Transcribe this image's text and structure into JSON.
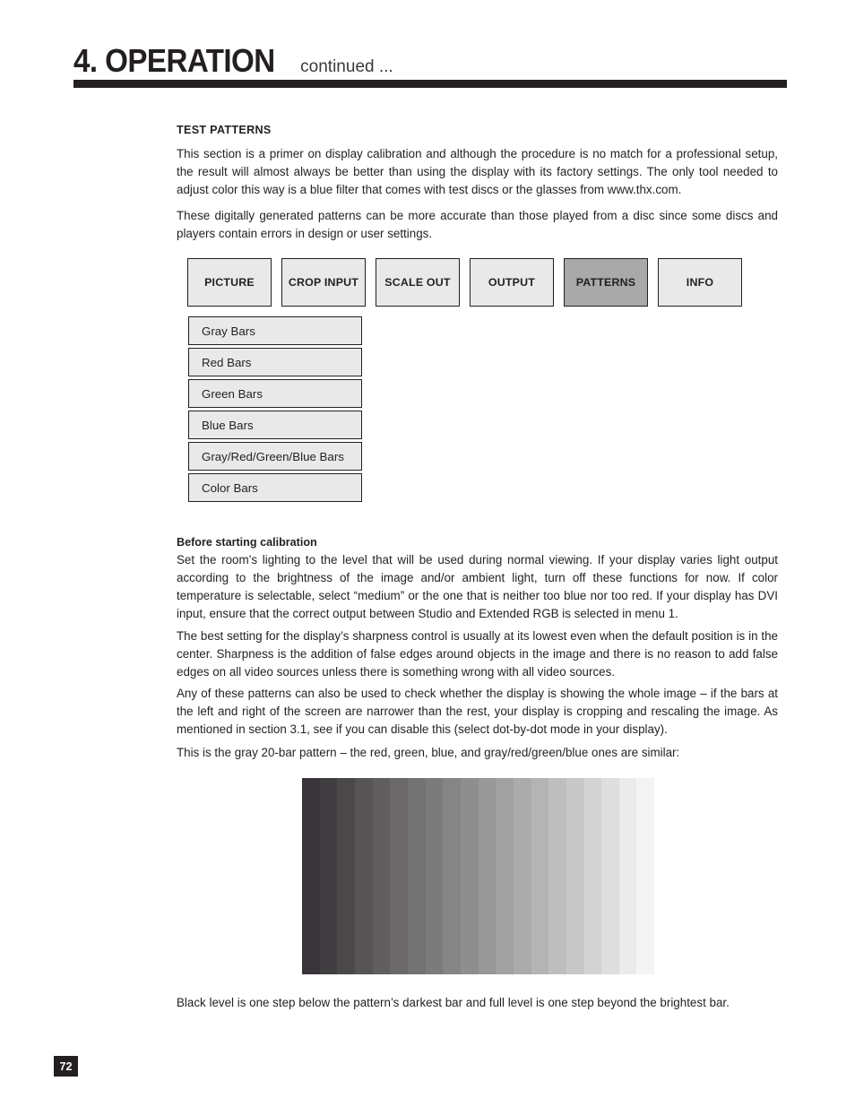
{
  "header": {
    "chapter": "4. OPERATION",
    "continued": "continued ..."
  },
  "section": {
    "title": "TEST PATTERNS",
    "intro_paragraph_1": "This section is a primer on display calibration and although the procedure is no match for a professional setup, the result will almost always be better than using the display with its factory settings. The only tool needed to adjust color this way is a blue filter that comes with test discs or the glasses from www.thx.com.",
    "intro_paragraph_2": "These digitally generated patterns can be more accurate than those played from a disc since some discs and players contain errors in design or user settings."
  },
  "tabs": [
    {
      "label": "PICTURE",
      "active": false
    },
    {
      "label": "CROP INPUT",
      "active": false
    },
    {
      "label": "SCALE OUT",
      "active": false
    },
    {
      "label": "OUTPUT",
      "active": false
    },
    {
      "label": "PATTERNS",
      "active": true
    },
    {
      "label": "INFO",
      "active": false
    }
  ],
  "menu_items": [
    {
      "label": "Gray Bars"
    },
    {
      "label": "Red Bars"
    },
    {
      "label": "Green Bars"
    },
    {
      "label": "Blue Bars"
    },
    {
      "label": "Gray/Red/Green/Blue Bars"
    },
    {
      "label": "Color Bars"
    }
  ],
  "calibration": {
    "heading": "Before starting calibration",
    "paragraph_1": "Set the room’s lighting to the level that will be used during normal viewing. If your display varies light output according to the brightness of the image and/or ambient light, turn off these functions for now. If color temperature is selectable, select “medium” or the one that is neither too blue nor too red. If your display has DVI input, ensure that the correct output between Studio and Extended RGB is selected in menu 1.",
    "paragraph_2": "The best setting for the display’s sharpness control is usually at its lowest even when the default position is in the center. Sharpness is the addition of false edges around objects in the image and there is no reason to add false edges on all video sources unless there is something wrong with all video sources.",
    "paragraph_3": "Any of these patterns can also be used to check whether the display is showing the whole image – if the bars at the left and right of the screen are narrower than the rest, your display is cropping and rescaling the image. As mentioned in section 3.1, see if you can disable this (select dot-by-dot mode in your display).",
    "paragraph_4": "This is the gray 20-bar pattern – the red, green, blue, and gray/red/green/blue ones are similar:",
    "caption": "Black level is one step below the pattern’s darkest bar and full level is one step beyond the brightest bar."
  },
  "gray_pattern": {
    "bar_count": 20,
    "colors": [
      "#38343a",
      "#413e42",
      "#4b4849",
      "#565454",
      "#605e5e",
      "#6a6868",
      "#737272",
      "#7c7b7b",
      "#868585",
      "#8f8e8e",
      "#999898",
      "#a2a1a1",
      "#acabab",
      "#b5b4b4",
      "#bfbebe",
      "#c8c8c8",
      "#d3d3d3",
      "#dedede",
      "#ebebeb",
      "#f4f4f4"
    ]
  },
  "footer": {
    "page_number": "72"
  },
  "colors": {
    "ink": "#231f20",
    "tab_fill": "#e9e9e9",
    "tab_active_fill": "#a9a9a9"
  }
}
